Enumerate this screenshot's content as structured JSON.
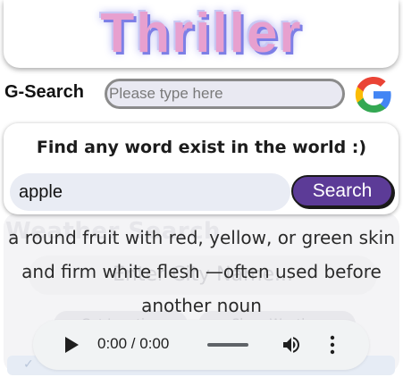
{
  "app": {
    "logo_text": "Thriller"
  },
  "google_search": {
    "label": "G-Search",
    "placeholder": "Please type here",
    "icon": "google-g-icon"
  },
  "dictionary": {
    "heading": "Find any word exist in the world :)",
    "query_value": "apple",
    "search_label": "Search",
    "definition": "a round fruit with red, yellow, or green skin and firm white flesh —often used before another noun"
  },
  "background_app": {
    "title": "Weather Search",
    "city_placeholder": "Enter City Name...",
    "buttons": [
      "Get Location",
      "Show Weather"
    ]
  },
  "audio_player": {
    "time": "0:00 / 0:00",
    "progress": 0,
    "icons": [
      "play-icon",
      "volume-icon",
      "more-options-icon"
    ]
  },
  "colors": {
    "logo_pink": "#e7a0cf",
    "logo_shadow": "#7d7fe6",
    "search_button": "#5c3b97",
    "input_bg": "#e9ecf4"
  }
}
